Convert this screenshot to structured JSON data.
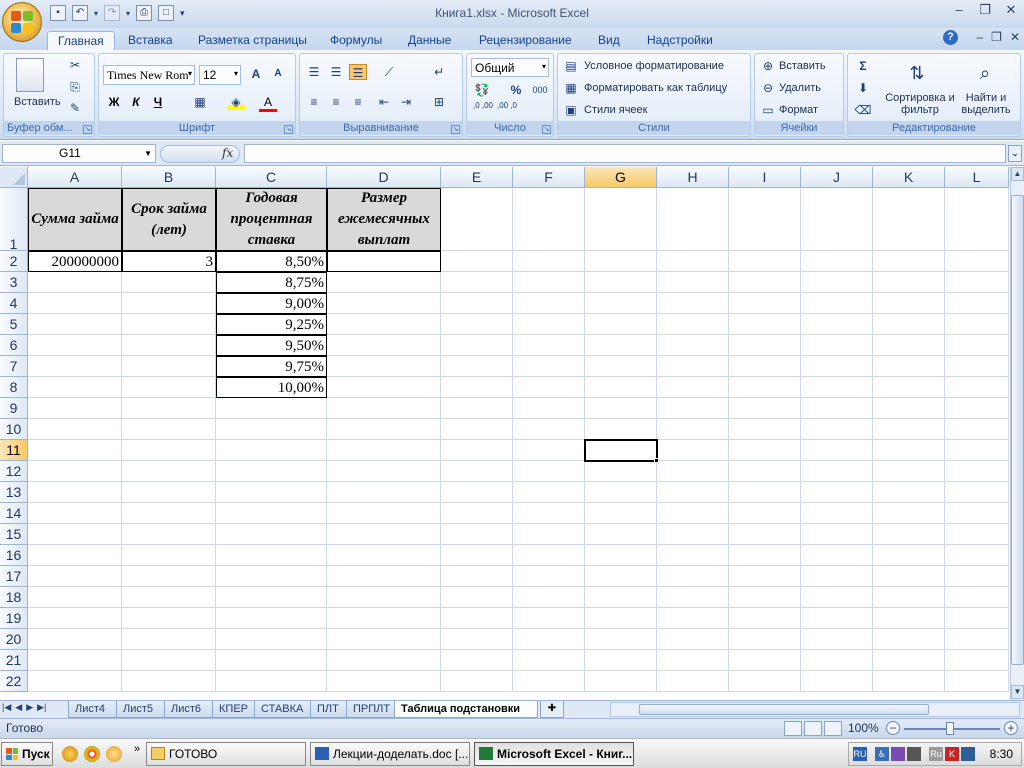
{
  "title_bar": {
    "title": "Книга1.xlsx - Microsoft Excel"
  },
  "ribbon": {
    "tabs": [
      "Главная",
      "Вставка",
      "Разметка страницы",
      "Формулы",
      "Данные",
      "Рецензирование",
      "Вид",
      "Надстройки"
    ],
    "active_tab": "Главная",
    "clipboard": {
      "paste_label": "Вставить",
      "group_title": "Буфер обм..."
    },
    "font": {
      "font_name": "Times New Rom",
      "font_size": "12",
      "bold_label": "Ж",
      "italic_label": "К",
      "underline_label": "Ч",
      "color_letter": "A",
      "grow_label": "A",
      "shrink_label": "A",
      "group_title": "Шрифт"
    },
    "alignment": {
      "group_title": "Выравнивание"
    },
    "number": {
      "format": "Общий",
      "percent_label": "%",
      "thousands_label": "000",
      "inc_decimal": ",0 ,00",
      "dec_decimal": ",00 ,0",
      "group_title": "Число"
    },
    "styles": {
      "conditional_label": "Условное форматирование",
      "format_table_label": "Форматировать как таблицу",
      "cell_styles_label": "Стили ячеек",
      "group_title": "Стили"
    },
    "cells": {
      "insert_label": "Вставить",
      "delete_label": "Удалить",
      "format_label": "Формат",
      "group_title": "Ячейки"
    },
    "editing": {
      "sigma": "Σ",
      "sort_filter_label": "Сортировка и фильтр",
      "find_label": "Найти и выделить",
      "group_title": "Редактирование"
    }
  },
  "formula_bar": {
    "name_box": "G11",
    "fx": "fx",
    "formula": ""
  },
  "columns": [
    "A",
    "B",
    "C",
    "D",
    "E",
    "F",
    "G",
    "H",
    "I",
    "J",
    "K",
    "L"
  ],
  "selected_column": "G",
  "rows": [
    "1",
    "2",
    "3",
    "4",
    "5",
    "6",
    "7",
    "8",
    "9",
    "10",
    "11",
    "12",
    "13",
    "14",
    "15",
    "16",
    "17",
    "18",
    "19",
    "20",
    "21",
    "22"
  ],
  "selected_row": "11",
  "table": {
    "headers": [
      "Сумма займа",
      "Срок займа (лет)",
      "Годовая процентная ставка",
      "Размер ежемесячных выплат"
    ],
    "loan_amount": "200000000",
    "term_years": "3",
    "rates": [
      "8,50%",
      "8,75%",
      "9,00%",
      "9,25%",
      "9,50%",
      "9,75%",
      "10,00%"
    ]
  },
  "sheet_tabs": [
    "Лист4",
    "Лист5",
    "Лист6",
    "КПЕР",
    "СТАВКА",
    "ПЛТ",
    "ПРПЛТ",
    "Таблица подстановки"
  ],
  "active_sheet": "Таблица подстановки",
  "status_bar": {
    "status": "Готово",
    "zoom": "100%"
  },
  "taskbar": {
    "start_label": "Пуск",
    "tasks": [
      "ГОТОВО",
      "Лекции-доделать.doc [...",
      "Microsoft Excel - Книг..."
    ],
    "language": "RU",
    "clock": "8:30"
  },
  "colors": {
    "header_fill": "#d9d9d9",
    "selection_highlight": "#f8c86a",
    "ribbon_blue": "#15428b"
  }
}
